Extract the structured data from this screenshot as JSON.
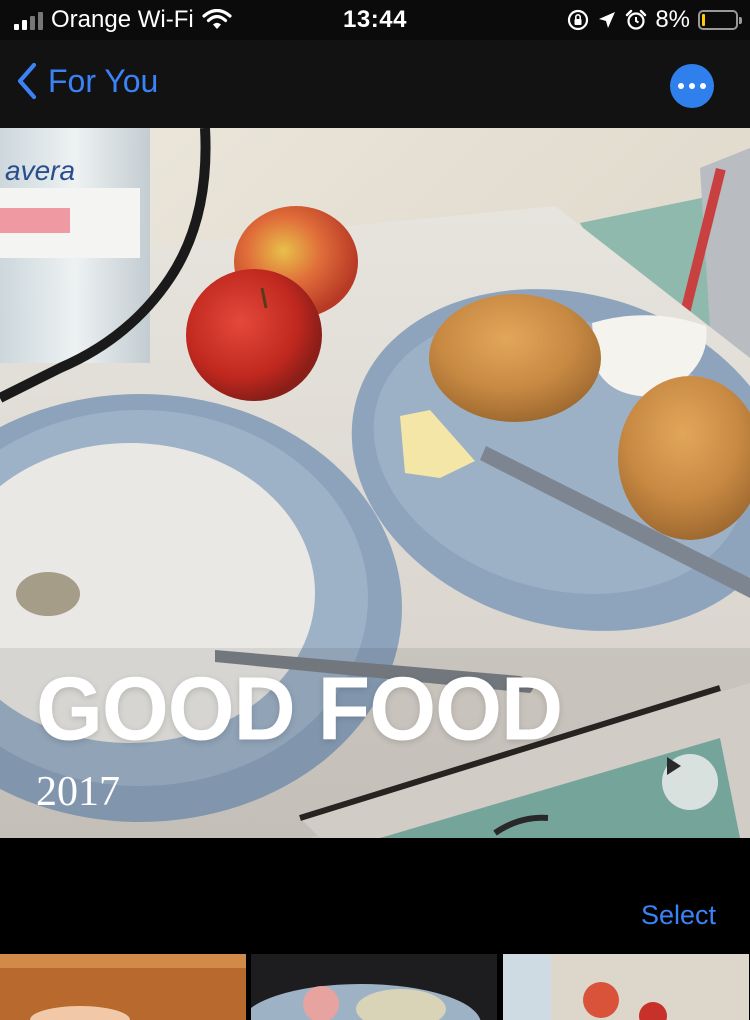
{
  "status_bar": {
    "carrier": "Orange Wi-Fi",
    "time": "13:44",
    "battery_percent": "8%",
    "battery_level": 0.08,
    "icons": [
      "signal-icon",
      "wifi-icon",
      "orientation-lock-icon",
      "location-icon",
      "alarm-icon",
      "battery-icon"
    ]
  },
  "nav": {
    "back_label": "For You",
    "more_icon": "ellipsis-icon",
    "accent_color": "#3b82f6"
  },
  "memory": {
    "title": "GOOD FOOD",
    "year": "2017",
    "play_icon": "play-icon"
  },
  "section": {
    "select_label": "Select"
  },
  "thumbnails": [
    "thumbnail-1",
    "thumbnail-2",
    "thumbnail-3"
  ]
}
